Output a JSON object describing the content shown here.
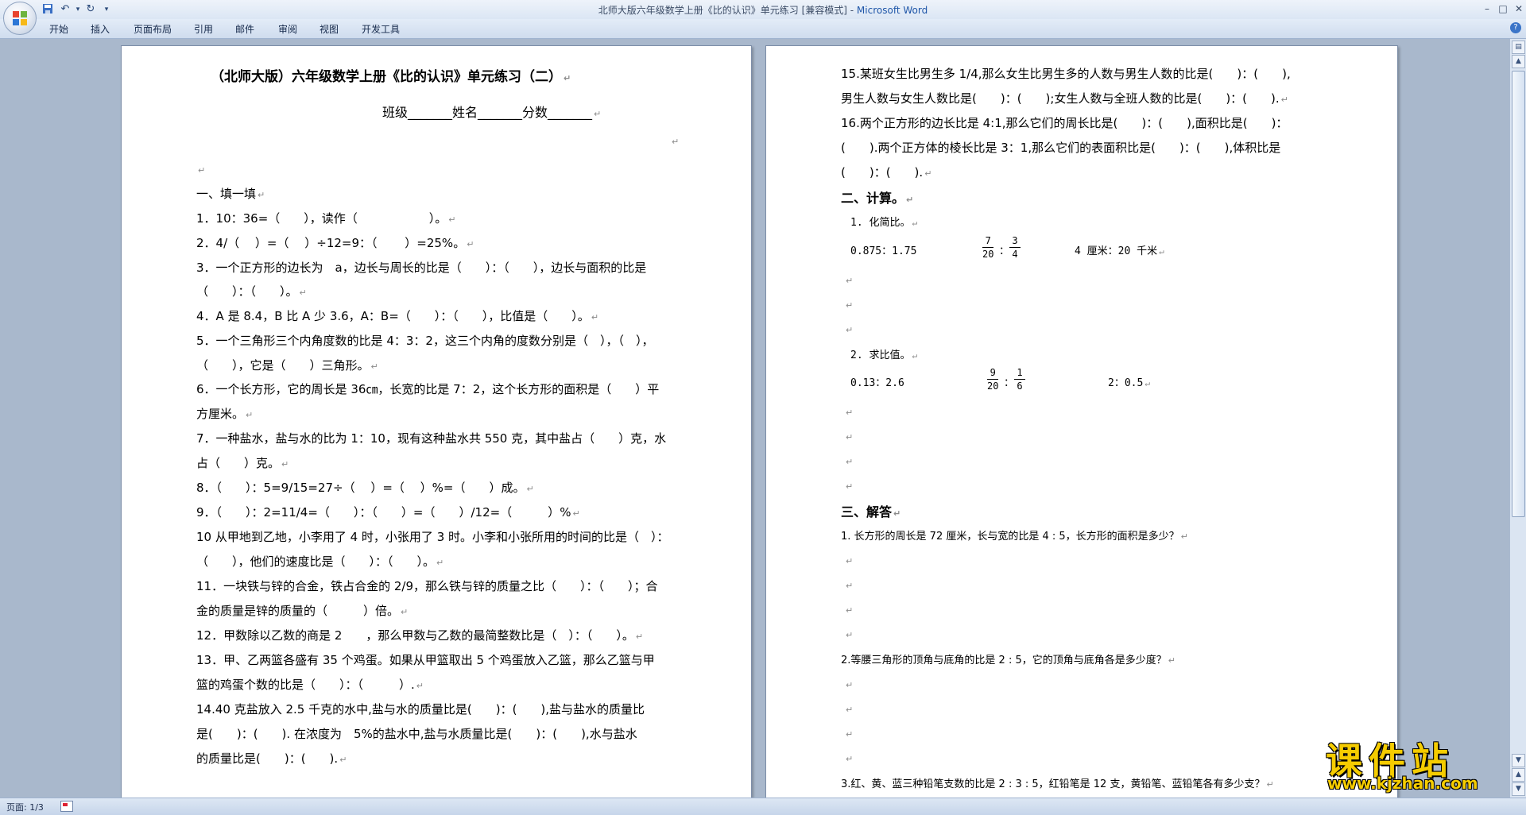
{
  "window": {
    "title_doc": "北师大版六年级数学上册《比的认识》单元练习 [兼容模式] - ",
    "title_app": "Microsoft Word",
    "qat": {
      "save_icon": "save-icon",
      "undo_icon": "undo-icon",
      "redo_icon": "redo-icon",
      "dropdown": "▾"
    },
    "controls": {
      "minimize": "–",
      "maximize": "□",
      "close": "✕"
    },
    "help": "?"
  },
  "tabs": [
    "开始",
    "插入",
    "页面布局",
    "引用",
    "邮件",
    "审阅",
    "视图",
    "开发工具"
  ],
  "page1": {
    "title": "（北师大版）六年级数学上册《比的认识》单元练习（二）",
    "student_line": "班级_______姓名_______分数_______",
    "section1": "一、填一填",
    "items": [
      "1．10：36=（　　），读作（　　　　　　）。",
      "2．4/（　 ）=（　 ）÷12=9：（　　 ）=25%。",
      "3．一个正方形的边长为　a，边长与周长的比是（　　）：（　　），边长与面积的比是",
      "（　　）：（　　）。",
      "4．A 是 8.4，B 比 A 少 3.6，A：B=（　　）：（　　），比值是（　　）。",
      "5．一个三角形三个内角度数的比是 4：3：2，这三个内角的度数分别是（　），（　），",
      "（　　），它是（　　）三角形。",
      "6．一个长方形，它的周长是 36㎝，长宽的比是 7：2，这个长方形的面积是（　　）平",
      "方厘米。",
      "7．一种盐水，盐与水的比为 1：10，现有这种盐水共 550 克，其中盐占（　　）克，水",
      "占（　　）克。",
      "8．（　　）：5=9/15=27÷（　 ）=（　 ）%=（　　）成。",
      "9．（　　）：2=11/4=（　　）：（　　）=（　　）/12=（　　　）%",
      "10 从甲地到乙地，小李用了 4 时，小张用了 3 时。小李和小张所用的时间的比是（　）：",
      "（　　），他们的速度比是（　　）：（　　）。",
      "11．一块铁与锌的合金，铁占合金的 2/9，那么铁与锌的质量之比（　　）：（　　）；合",
      "金的质量是锌的质量的（　　　）倍。",
      "12．甲数除以乙数的商是 2　　，那么甲数与乙数的最简整数比是（　）：（　　）。",
      "13．甲、乙两篮各盛有 35 个鸡蛋。如果从甲篮取出 5 个鸡蛋放入乙篮，那么乙篮与甲",
      "篮的鸡蛋个数的比是（　　）：（　　　）.",
      "14.40 克盐放入 2.5 千克的水中,盐与水的质量比是(　　)：(　　),盐与盐水的质量比",
      "是(　　)：(　　). 在浓度为　5%的盐水中,盐与水质量比是(　　)：(　　),水与盐水",
      "的质量比是(　　)：(　　)."
    ]
  },
  "page2": {
    "items": [
      "15.某班女生比男生多 1/4,那么女生比男生多的人数与男生人数的比是(　　)：(　　),",
      "男生人数与女生人数比是(　　)：(　　);女生人数与全班人数的比是(　　)：(　　).",
      "16.两个正方形的边长比是 4:1,那么它们的周长比是(　　)：(　　),面积比是(　　)：",
      "(　　).两个正方体的棱长比是 3：1,那么它们的表面积比是(　　)：(　　),体积比是",
      "(　　)：(　　)."
    ],
    "section2": "二、计算。",
    "sub1": "1. 化简比。",
    "calc1_a": "0.875：1.75",
    "calc1_b_frac1": {
      "num": "7",
      "den": "20"
    },
    "calc1_b_frac2": {
      "num": "3",
      "den": "4"
    },
    "calc1_c": "4 厘米：20 千米",
    "sub2": "2. 求比值。",
    "calc2_a": "0.13：2.6",
    "calc2_b_frac1": {
      "num": "9",
      "den": "20"
    },
    "calc2_b_frac2": {
      "num": "1",
      "den": "6"
    },
    "calc2_c": "2：0.5",
    "ratio_sep": "：",
    "section3": "三、解答",
    "q1": "1. 长方形的周长是 72 厘米，长与宽的比是 4 : 5，长方形的面积是多少？",
    "q2": "2.等腰三角形的顶角与底角的比是 2 : 5，它的顶角与底角各是多少度？",
    "q3": "3.红、黄、蓝三种铅笔支数的比是 2 : 3 : 5，红铅笔是 12 支，黄铅笔、蓝铅笔各有多少支？"
  },
  "para_mark": "↵",
  "status": {
    "page": "页面: 1/3"
  },
  "watermark": {
    "cn": "课件站",
    "url": "www.kjzhan.com"
  },
  "colors": {
    "accent": "#1f56a8",
    "background": "#a9b8cc",
    "watermark": "#f5cc00"
  }
}
